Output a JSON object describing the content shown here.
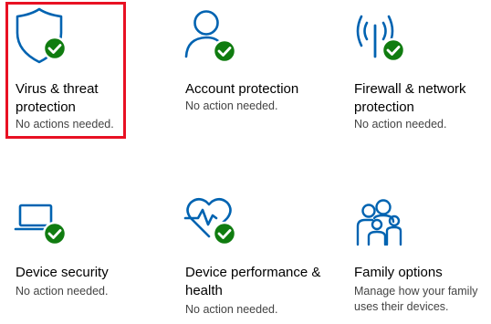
{
  "colors": {
    "icon_blue": "#0063b1",
    "check_green": "#107c10",
    "focus_red": "#e81123"
  },
  "tiles": [
    {
      "icon": "shield-icon",
      "title": "Virus & threat protection",
      "status": "No actions needed.",
      "status_icon": "green-check-icon",
      "selected": true
    },
    {
      "icon": "person-icon",
      "title": "Account protection",
      "status": "No action needed.",
      "status_icon": "green-check-icon"
    },
    {
      "icon": "antenna-icon",
      "title": "Firewall & network protection",
      "status": "No action needed.",
      "status_icon": "green-check-icon"
    },
    {
      "icon": "laptop-icon",
      "title": "Device security",
      "status": "No action needed.",
      "status_icon": "green-check-icon"
    },
    {
      "icon": "heart-pulse-icon",
      "title": "Device performance & health",
      "status": "No action needed.",
      "status_icon": "green-check-icon"
    },
    {
      "icon": "family-icon",
      "title": "Family options",
      "status": "Manage how your family uses their devices."
    }
  ]
}
